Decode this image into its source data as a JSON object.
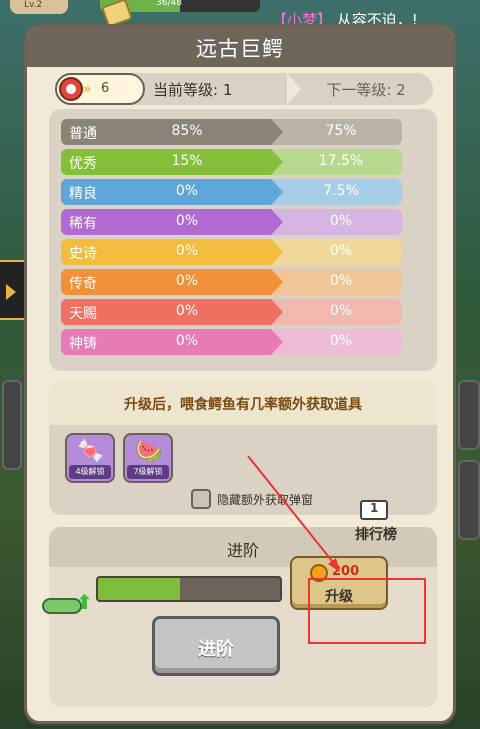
{
  "background": {
    "player_level_badge": "Lv.2",
    "exp_text": "36/48"
  },
  "notice": {
    "speaker": "【小梦】",
    "message": "从容不迫，!"
  },
  "panel": {
    "title": "远古巨鳄",
    "level_badge_number": "6",
    "current_level": "当前等级: 1",
    "next_level": "下一等级: 2"
  },
  "rates": [
    {
      "name": "普通",
      "current": "85%",
      "next": "75%",
      "color": "#8a8478",
      "next_color": "#b9b3a6"
    },
    {
      "name": "优秀",
      "current": "15%",
      "next": "17.5%",
      "color": "#85bf3a",
      "next_color": "#b7d98d"
    },
    {
      "name": "精良",
      "current": "0%",
      "next": "7.5%",
      "color": "#5ea6d9",
      "next_color": "#a6cde8"
    },
    {
      "name": "稀有",
      "current": "0%",
      "next": "0%",
      "color": "#b06ad1",
      "next_color": "#d5b3e3"
    },
    {
      "name": "史诗",
      "current": "0%",
      "next": "0%",
      "color": "#f2bd3c",
      "next_color": "#f1d89a"
    },
    {
      "name": "传奇",
      "current": "0%",
      "next": "0%",
      "color": "#f0913a",
      "next_color": "#f1c596"
    },
    {
      "name": "天赐",
      "current": "0%",
      "next": "0%",
      "color": "#ef7060",
      "next_color": "#f1b8ae"
    },
    {
      "name": "神铸",
      "current": "0%",
      "next": "0%",
      "color": "#e77bb6",
      "next_color": "#efbcd8"
    }
  ],
  "bonus": {
    "title": "升级后，喂食鳄鱼有几率额外获取道具",
    "items": [
      {
        "icon": "candy-icon",
        "glyph": "🍬",
        "unlock": "4级解锁",
        "bg": "#b58ad8"
      },
      {
        "icon": "watermelon-icon",
        "glyph": "🍉",
        "unlock": "7级解锁",
        "bg": "#b58ad8"
      }
    ],
    "checkbox_label": "隐藏额外获取弹窗"
  },
  "advance": {
    "title": "进阶",
    "ranking_label": "排行榜",
    "progress_fraction": 0.45,
    "upgrade_cost": "200",
    "upgrade_label": "升级",
    "advance_label": "进阶"
  }
}
